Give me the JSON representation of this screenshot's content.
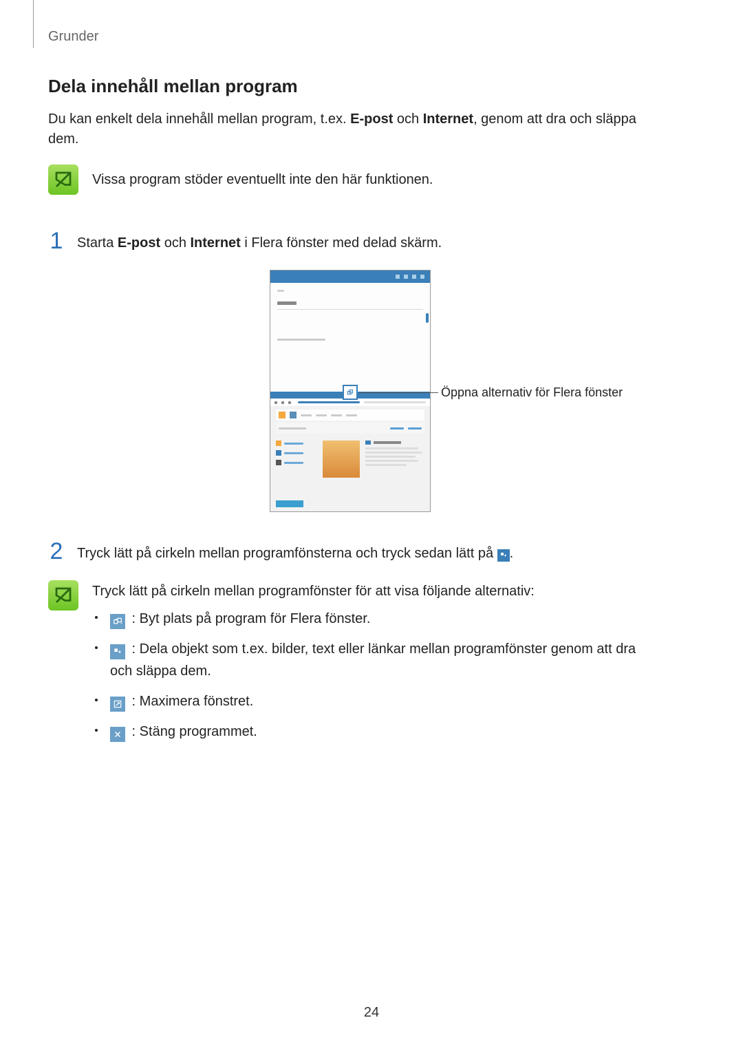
{
  "header": {
    "breadcrumb": "Grunder"
  },
  "section": {
    "title": "Dela innehåll mellan program",
    "intro_pre": "Du kan enkelt dela innehåll mellan program, t.ex. ",
    "intro_b1": "E-post",
    "intro_mid": " och ",
    "intro_b2": "Internet",
    "intro_post": ", genom att dra och släppa dem."
  },
  "note1": {
    "text": "Vissa program stöder eventuellt inte den här funktionen."
  },
  "steps": [
    {
      "num": "1",
      "pre": "Starta ",
      "b1": "E-post",
      "mid": " och ",
      "b2": "Internet",
      "post": " i Flera fönster med delad skärm."
    },
    {
      "num": "2",
      "text": "Tryck lätt på cirkeln mellan programfönsterna och tryck sedan lätt på ",
      "tail": "."
    }
  ],
  "callout": {
    "label": "Öppna alternativ för Flera fönster"
  },
  "note2": {
    "intro": "Tryck lätt på cirkeln mellan programfönster för att visa följande alternativ:",
    "items": [
      {
        "icon": "swap",
        "text": " : Byt plats på program för Flera fönster."
      },
      {
        "icon": "share",
        "text": " : Dela objekt som t.ex. bilder, text eller länkar mellan programfönster genom att dra och släppa dem."
      },
      {
        "icon": "maximize",
        "text": " : Maximera fönstret."
      },
      {
        "icon": "close",
        "text": " : Stäng programmet."
      }
    ]
  },
  "page": {
    "number": "24"
  }
}
